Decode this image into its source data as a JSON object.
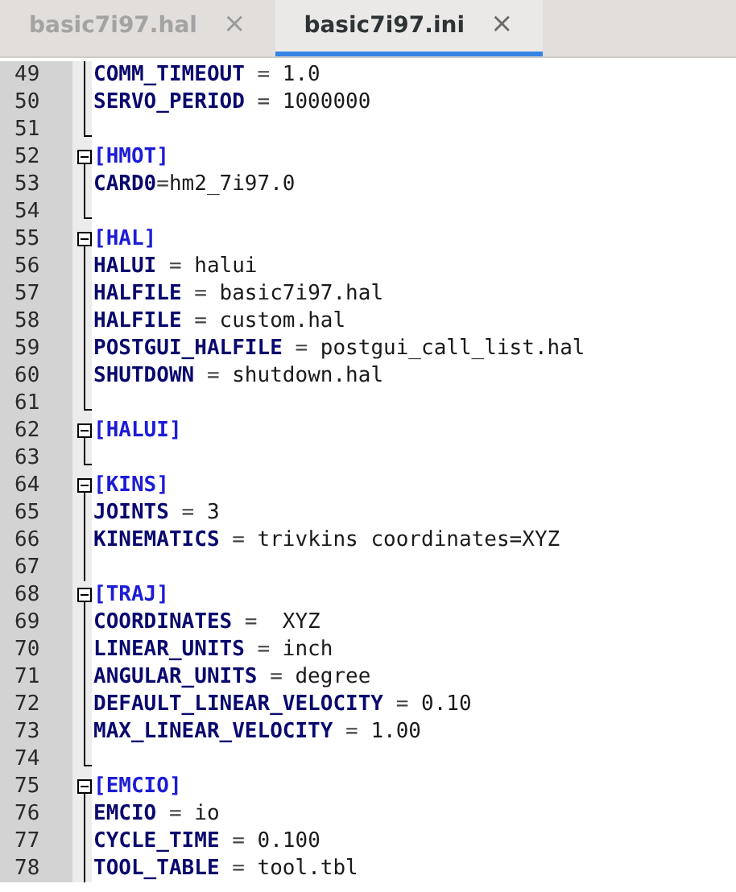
{
  "tabs": [
    {
      "label": "basic7i97.hal",
      "selected": false,
      "close": "×"
    },
    {
      "label": "basic7i97.ini",
      "selected": true,
      "close": "×"
    }
  ],
  "lines": [
    {
      "number": "49",
      "kind": "entry",
      "key": "COMM_TIMEOUT",
      "separator": " = ",
      "value": "1.0"
    },
    {
      "number": "50",
      "kind": "entry",
      "key": "SERVO_PERIOD",
      "separator": " = ",
      "value": "1000000"
    },
    {
      "number": "51",
      "kind": "end"
    },
    {
      "number": "52",
      "kind": "header",
      "text": "[HMOT]"
    },
    {
      "number": "53",
      "kind": "entry",
      "key": "CARD0",
      "separator": "=",
      "value": "hm2_7i97.0"
    },
    {
      "number": "54",
      "kind": "end"
    },
    {
      "number": "55",
      "kind": "header",
      "text": "[HAL]"
    },
    {
      "number": "56",
      "kind": "entry",
      "key": "HALUI",
      "separator": " = ",
      "value": "halui"
    },
    {
      "number": "57",
      "kind": "entry",
      "key": "HALFILE",
      "separator": " = ",
      "value": "basic7i97.hal"
    },
    {
      "number": "58",
      "kind": "entry",
      "key": "HALFILE",
      "separator": " = ",
      "value": "custom.hal"
    },
    {
      "number": "59",
      "kind": "entry",
      "key": "POSTGUI_HALFILE",
      "separator": " = ",
      "value": "postgui_call_list.hal"
    },
    {
      "number": "60",
      "kind": "entry",
      "key": "SHUTDOWN",
      "separator": " = ",
      "value": "shutdown.hal"
    },
    {
      "number": "61",
      "kind": "end"
    },
    {
      "number": "62",
      "kind": "header",
      "text": "[HALUI]"
    },
    {
      "number": "63",
      "kind": "end"
    },
    {
      "number": "64",
      "kind": "header",
      "text": "[KINS]"
    },
    {
      "number": "65",
      "kind": "entry",
      "key": "JOINTS",
      "separator": " = ",
      "value": "3"
    },
    {
      "number": "66",
      "kind": "entry",
      "key": "KINEMATICS",
      "separator": " = ",
      "value": "trivkins coordinates=XYZ"
    },
    {
      "number": "67",
      "kind": "empty"
    },
    {
      "number": "68",
      "kind": "header",
      "text": "[TRAJ]"
    },
    {
      "number": "69",
      "kind": "entry",
      "key": "COORDINATES",
      "separator": " =  ",
      "value": "XYZ"
    },
    {
      "number": "70",
      "kind": "entry",
      "key": "LINEAR_UNITS",
      "separator": " = ",
      "value": "inch"
    },
    {
      "number": "71",
      "kind": "entry",
      "key": "ANGULAR_UNITS",
      "separator": " = ",
      "value": "degree"
    },
    {
      "number": "72",
      "kind": "entry",
      "key": "DEFAULT_LINEAR_VELOCITY",
      "separator": " = ",
      "value": "0.10"
    },
    {
      "number": "73",
      "kind": "entry",
      "key": "MAX_LINEAR_VELOCITY",
      "separator": " = ",
      "value": "1.00"
    },
    {
      "number": "74",
      "kind": "end"
    },
    {
      "number": "75",
      "kind": "header",
      "text": "[EMCIO]"
    },
    {
      "number": "76",
      "kind": "entry",
      "key": "EMCIO",
      "separator": " = ",
      "value": "io"
    },
    {
      "number": "77",
      "kind": "entry",
      "key": "CYCLE_TIME",
      "separator": " = ",
      "value": "0.100"
    },
    {
      "number": "78",
      "kind": "entry",
      "key": "TOOL_TABLE",
      "separator": " = ",
      "value": "tool.tbl"
    }
  ]
}
